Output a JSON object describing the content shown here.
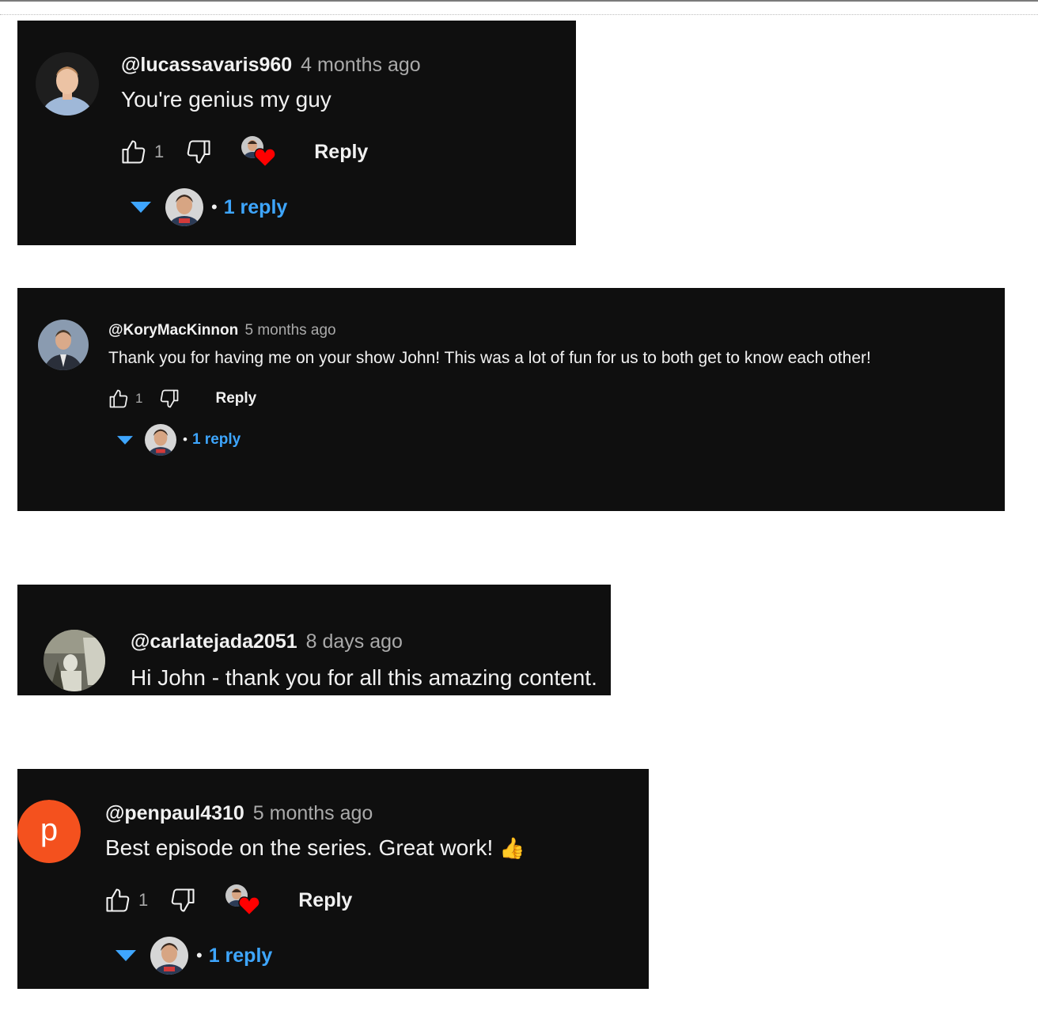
{
  "comments": [
    {
      "handle": "@lucassavaris960",
      "time": "4 months ago",
      "text": "You're genius my guy",
      "likes": "1",
      "reply_label": "Reply",
      "replies_label": "1 reply",
      "dot": "•",
      "hearted": true,
      "avatar_icon": "person-avatar-icon"
    },
    {
      "handle": "@KoryMacKinnon",
      "time": "5 months ago",
      "text": "Thank you for having me on your show John!  This was a lot of fun for us to both get to know each other!",
      "likes": "1",
      "reply_label": "Reply",
      "replies_label": "1 reply",
      "dot": "•",
      "hearted": false,
      "avatar_icon": "person-avatar-icon"
    },
    {
      "handle": "@carlatejada2051",
      "time": "8 days ago",
      "text": "Hi John - thank you for all this amazing content.",
      "avatar_icon": "person-avatar-icon"
    },
    {
      "handle": "@penpaul4310",
      "time": "5 months ago",
      "text": "Best episode on the series. Great work!",
      "emoji": "👍",
      "likes": "1",
      "reply_label": "Reply",
      "replies_label": "1 reply",
      "dot": "•",
      "hearted": true,
      "avatar_letter": "p",
      "avatar_color": "#f4511e"
    }
  ],
  "colors": {
    "card_bg": "#0f0f0f",
    "text": "#f1f1f1",
    "muted": "#aaaaaa",
    "link": "#3ea6ff",
    "heart": "#ff0000"
  }
}
